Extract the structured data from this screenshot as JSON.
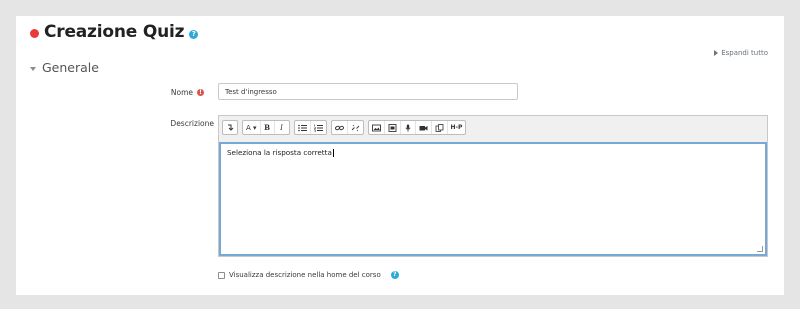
{
  "header": {
    "title": "Creazione Quiz",
    "expand_all": "Espandi tutto"
  },
  "section": {
    "title": "Generale"
  },
  "fields": {
    "nome_label": "Nome",
    "nome_value": "Test d'ingresso",
    "descrizione_label": "Descrizione",
    "descrizione_value": "Seleziona la risposta corretta"
  },
  "toolbar": {
    "items": [
      {
        "icon": "collapse-toggle-icon"
      },
      {
        "icon": "paragraph-style-icon",
        "label": "A ▾"
      },
      {
        "icon": "bold-icon",
        "label": "B"
      },
      {
        "icon": "italic-icon",
        "label": "I"
      },
      {
        "icon": "unordered-list-icon"
      },
      {
        "icon": "ordered-list-icon"
      },
      {
        "icon": "link-icon"
      },
      {
        "icon": "unlink-icon"
      },
      {
        "icon": "image-icon"
      },
      {
        "icon": "media-icon"
      },
      {
        "icon": "record-audio-icon"
      },
      {
        "icon": "record-video-icon"
      },
      {
        "icon": "manage-files-icon"
      },
      {
        "icon": "h5p-icon",
        "label": "H-P"
      }
    ]
  },
  "checkbox": {
    "label": "Visualizza descrizione nella home del corso",
    "checked": false
  },
  "colors": {
    "required": "#e83a3a",
    "help": "#2ba9d8",
    "focus_border": "#78a9d6"
  }
}
